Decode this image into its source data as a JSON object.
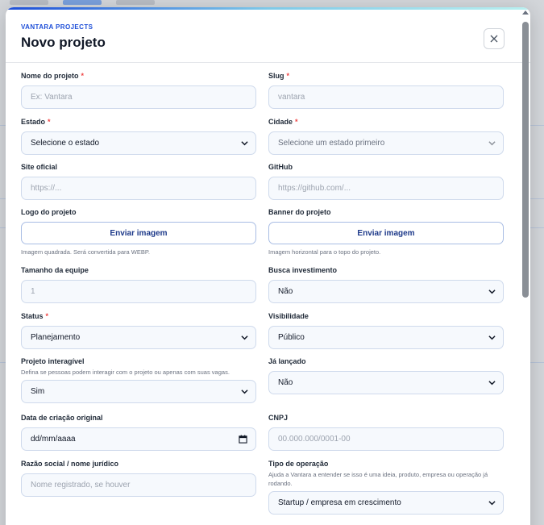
{
  "header": {
    "eyebrow": "VANTARA PROJECTS",
    "title": "Novo projeto",
    "close_icon": "close-icon"
  },
  "fields": {
    "nome": {
      "label": "Nome do projeto",
      "placeholder": "Ex: Vantara"
    },
    "slug": {
      "label": "Slug",
      "placeholder": "vantara"
    },
    "estado": {
      "label": "Estado",
      "value": "Selecione o estado"
    },
    "cidade": {
      "label": "Cidade",
      "value": "Selecione um estado primeiro"
    },
    "site": {
      "label": "Site oficial",
      "placeholder": "https://..."
    },
    "github": {
      "label": "GitHub",
      "placeholder": "https://github.com/..."
    },
    "logo": {
      "label": "Logo do projeto",
      "button": "Enviar imagem",
      "hint": "Imagem quadrada. Será convertida para WEBP."
    },
    "banner": {
      "label": "Banner do projeto",
      "button": "Enviar imagem",
      "hint": "Imagem horizontal para o topo do projeto."
    },
    "tamanho": {
      "label": "Tamanho da equipe",
      "value": "1"
    },
    "investimento": {
      "label": "Busca investimento",
      "value": "Não"
    },
    "status": {
      "label": "Status",
      "value": "Planejamento"
    },
    "visibilidade": {
      "label": "Visibilidade",
      "value": "Público"
    },
    "interagivel": {
      "label": "Projeto interagível",
      "description": "Defina se pessoas podem interagir com o projeto ou apenas com suas vagas.",
      "value": "Sim"
    },
    "lancado": {
      "label": "Já lançado",
      "value": "Não"
    },
    "data_criacao": {
      "label": "Data de criação original",
      "value": "dd/mm/aaaa"
    },
    "cnpj": {
      "label": "CNPJ",
      "placeholder": "00.000.000/0001-00"
    },
    "razao": {
      "label": "Razão social / nome jurídico",
      "placeholder": "Nome registrado, se houver"
    },
    "operacao": {
      "label": "Tipo de operação",
      "description": "Ajuda a Vantara a entender se isso é uma ideia, produto, empresa ou operação já rodando.",
      "value": "Startup / empresa em crescimento"
    }
  },
  "required_mark": "*",
  "colors": {
    "accent": "#1d4ed8",
    "required": "#ef4444"
  }
}
